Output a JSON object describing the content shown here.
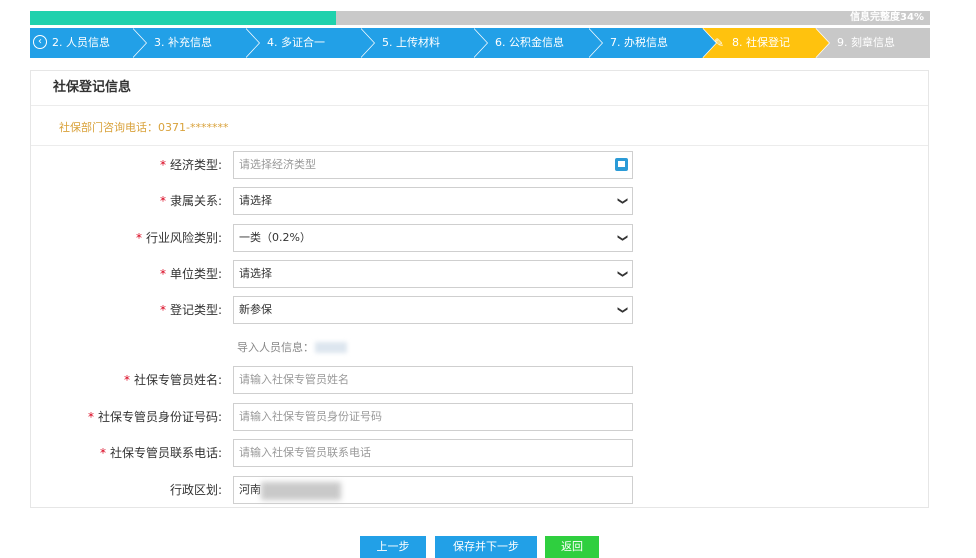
{
  "progress": {
    "percent": 34,
    "label": "信息完整度34%"
  },
  "steps": [
    {
      "label": "2. 人员信息",
      "status": "done"
    },
    {
      "label": "3. 补充信息",
      "status": "done"
    },
    {
      "label": "4. 多证合一",
      "status": "done"
    },
    {
      "label": "5. 上传材料",
      "status": "done"
    },
    {
      "label": "6. 公积金信息",
      "status": "done"
    },
    {
      "label": "7. 办税信息",
      "status": "done"
    },
    {
      "label": "8. 社保登记",
      "status": "active"
    },
    {
      "label": "9. 刻章信息",
      "status": "pending"
    }
  ],
  "panel": {
    "title": "社保登记信息",
    "phone_note": "社保部门咨询电话：0371-*******"
  },
  "form": {
    "economic_type": {
      "label": "经济类型:",
      "placeholder": "请选择经济类型"
    },
    "affiliation": {
      "label": "隶属关系:",
      "value": "请选择"
    },
    "risk_category": {
      "label": "行业风险类别:",
      "value": "一类（0.2%）"
    },
    "unit_type": {
      "label": "单位类型:",
      "value": "请选择"
    },
    "registration_type": {
      "label": "登记类型:",
      "value": "新参保"
    },
    "import_note": "导入人员信息：",
    "manager_name": {
      "label": "社保专管员姓名:",
      "placeholder": "请输入社保专管员姓名"
    },
    "manager_id": {
      "label": "社保专管员身份证号码:",
      "placeholder": "请输入社保专管员身份证号码"
    },
    "manager_phone": {
      "label": "社保专管员联系电话:",
      "placeholder": "请输入社保专管员联系电话"
    },
    "district": {
      "label": "行政区划:",
      "value": "河南"
    }
  },
  "required_mark": "*",
  "buttons": {
    "prev": "上一步",
    "save_next": "保存并下一步",
    "back": "返回"
  },
  "colors": {
    "step_done": "#22a0e7",
    "step_active": "#ffc20e",
    "progress_fill": "#1fd1ad",
    "back_button": "#2fcf3f"
  }
}
